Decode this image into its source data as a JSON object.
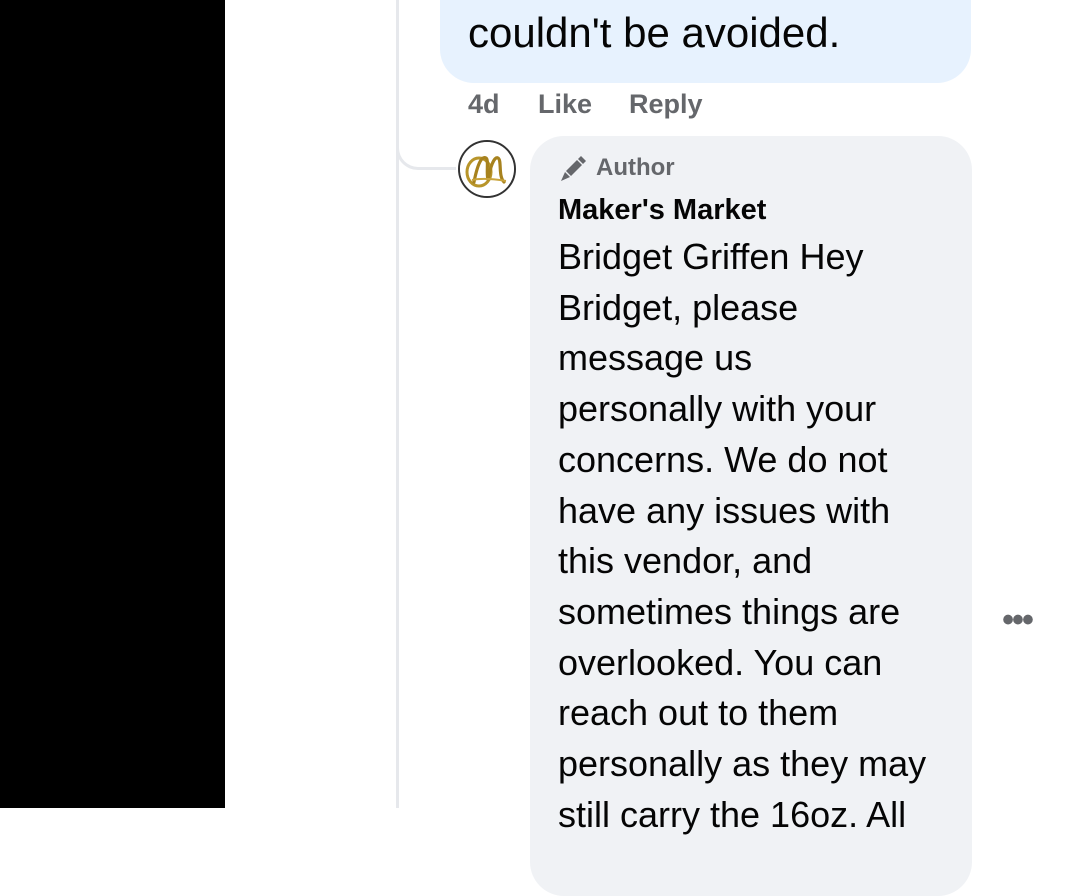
{
  "previous_comment": {
    "text_tail": "couldn't be avoided.",
    "time": "4d",
    "like_label": "Like",
    "reply_label": "Reply"
  },
  "reply": {
    "badge_icon": "pen-icon",
    "badge_label": "Author",
    "author_name": "Maker's Market",
    "avatar_initials": "M",
    "lines": [
      "Bridget Griffen Hey",
      "Bridget, please",
      "message us",
      "personally with your",
      "concerns. We do not",
      "have any issues with",
      "this vendor, and",
      "sometimes things are",
      "overlooked. You can",
      "reach out to them",
      "personally as they may",
      "still carry the 16oz. All"
    ],
    "more_icon": "more-options-icon"
  },
  "colors": {
    "left_panel": "#000000",
    "prev_bubble": "#e7f2fe",
    "reply_bubble": "#f0f2f5",
    "meta_text": "#65676b",
    "avatar_gold": "#b8952a"
  }
}
